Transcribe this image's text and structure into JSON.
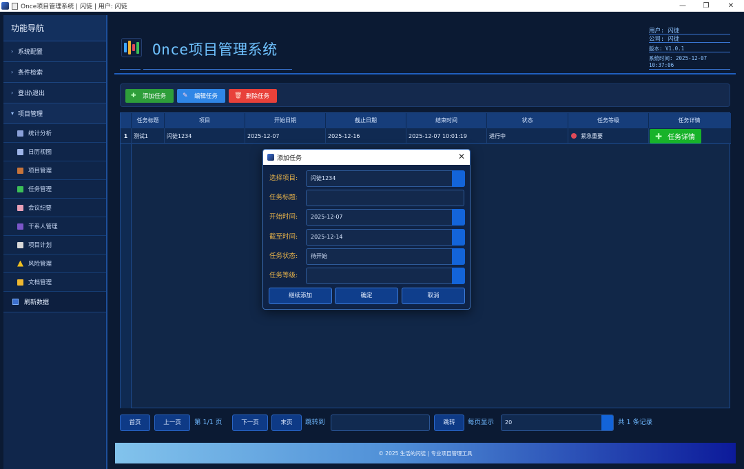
{
  "window": {
    "title": "Once项目管理系统 | 闪徒 | 用户: 闪徒"
  },
  "sidebar": {
    "heading": "功能导航",
    "items": [
      {
        "label": "系统配置"
      },
      {
        "label": "条件检索"
      },
      {
        "label": "登出\\退出"
      },
      {
        "label": "项目管理"
      }
    ],
    "sub_items": [
      {
        "label": "统计分析",
        "icon": "bar-chart-icon",
        "color": "#8aa0d8"
      },
      {
        "label": "日历视图",
        "icon": "calendar-icon",
        "color": "#9db4e8"
      },
      {
        "label": "项目管理",
        "icon": "book-icon",
        "color": "#c7743a"
      },
      {
        "label": "任务管理",
        "icon": "checkbox-icon",
        "color": "#3cbf58"
      },
      {
        "label": "会议纪要",
        "icon": "document-icon",
        "color": "#e9a0b7"
      },
      {
        "label": "干系人管理",
        "icon": "people-icon",
        "color": "#7b56c9"
      },
      {
        "label": "项目计划",
        "icon": "clipboard-icon",
        "color": "#d8d8d8"
      },
      {
        "label": "风险管理",
        "icon": "warning-icon",
        "color": "#f0c020"
      },
      {
        "label": "文档管理",
        "icon": "folder-icon",
        "color": "#f0b830"
      }
    ],
    "refresh_label": "刷新数据"
  },
  "header": {
    "app_title": "Once项目管理系统",
    "user": "用户: 闪徒",
    "company": "公司: 闪徒",
    "version": "版本: V1.0.1",
    "system_time": "系统时间: 2025-12-07 10:37:06"
  },
  "toolbar": {
    "add_label": "添加任务",
    "edit_label": "编辑任务",
    "delete_label": "删除任务",
    "colors": {
      "add": "#2e9e3a",
      "edit": "#2f86e6",
      "delete": "#e8413a"
    }
  },
  "table": {
    "columns": [
      "任务标题",
      "项目",
      "开始日期",
      "截止日期",
      "结束时间",
      "状态",
      "任务等级",
      "任务详情"
    ],
    "rows": [
      {
        "num": "1",
        "title": "测试1",
        "project": "闪徒1234",
        "start": "2025-12-07",
        "deadline": "2025-12-16",
        "end_time": "2025-12-07 10:01:19",
        "status": "进行中",
        "level": "紧急重要",
        "detail_label": "任务详情"
      }
    ]
  },
  "pager": {
    "first": "首页",
    "prev": "上一页",
    "page_info": "第 1/1 页",
    "next": "下一页",
    "last": "末页",
    "jump_label": "跳转到",
    "jump_button": "跳转",
    "per_page_label": "每页显示",
    "per_page_value": "20",
    "total": "共 1 条记录"
  },
  "footer": {
    "text": "© 2025 生活的闪徒  |  专业项目管理工具"
  },
  "dialog": {
    "title": "添加任务",
    "fields": [
      {
        "label": "选择项目:",
        "value": "闪徒1234"
      },
      {
        "label": "任务标题:",
        "value": ""
      },
      {
        "label": "开始时间:",
        "value": "2025-12-07"
      },
      {
        "label": "截至时间:",
        "value": "2025-12-14"
      },
      {
        "label": "任务状态:",
        "value": "待开始"
      },
      {
        "label": "任务等级:",
        "value": ""
      }
    ],
    "continue_label": "继续添加",
    "ok_label": "确定",
    "cancel_label": "取消"
  }
}
